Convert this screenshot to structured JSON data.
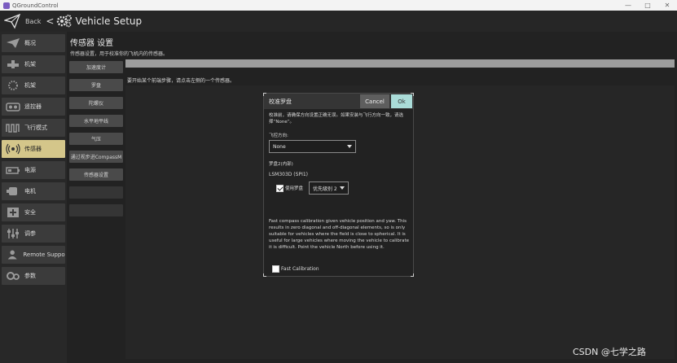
{
  "window": {
    "title": "QGroundControl",
    "controls": [
      "—",
      "□",
      "✕"
    ]
  },
  "toolbar": {
    "back_label": "Back",
    "back_arrow": "<",
    "title": "Vehicle Setup"
  },
  "sidebar": {
    "items": [
      {
        "label": "概况",
        "icon": "plane-icon",
        "active": false
      },
      {
        "label": "机架",
        "icon": "airframe-icon",
        "active": false
      },
      {
        "label": "机架",
        "icon": "spinner-icon",
        "active": false
      },
      {
        "label": "遥控器",
        "icon": "radio-icon",
        "active": false
      },
      {
        "label": "飞行模式",
        "icon": "waveform-icon",
        "active": false
      },
      {
        "label": "传感器",
        "icon": "signal-icon",
        "active": true
      },
      {
        "label": "电源",
        "icon": "battery-icon",
        "active": false
      },
      {
        "label": "电机",
        "icon": "motor-icon",
        "active": false
      },
      {
        "label": "安全",
        "icon": "safety-icon",
        "active": false
      },
      {
        "label": "调参",
        "icon": "tuning-icon",
        "active": false
      },
      {
        "label": "Remote Support",
        "icon": "person-icon",
        "active": false
      },
      {
        "label": "参数",
        "icon": "gears-icon",
        "active": false
      }
    ]
  },
  "main": {
    "heading": "传感器 设置",
    "subheading": "传感器设置，用于校准你的飞机内的传感器。",
    "instruction": "要开始某个前端步骤，请点击左侧的一个传感器。",
    "sensor_buttons": [
      {
        "label": "加速度计",
        "enabled": true
      },
      {
        "label": "罗盘",
        "enabled": true
      },
      {
        "label": "陀螺仪",
        "enabled": true
      },
      {
        "label": "水平地平线",
        "enabled": true
      },
      {
        "label": "气压",
        "enabled": true
      },
      {
        "label": "通过视步进CompassM",
        "enabled": true
      },
      {
        "label": "传感器设置",
        "enabled": true
      },
      {
        "label": "",
        "enabled": false
      },
      {
        "label": "",
        "enabled": false
      }
    ],
    "progress": 1.0
  },
  "dialog": {
    "title": "校准罗盘",
    "cancel_label": "Cancel",
    "ok_label": "Ok",
    "intro": "校准前，请确保方向设置正确无误。如果安装与飞行方向一致，请选择“None”。",
    "orientation_label": "飞控方向:",
    "orientation_value": "None",
    "compass_label": "罗盘2(内部)",
    "compass_name": "LSM303D (SPI1)",
    "use_compass_label": "使用罗盘",
    "use_compass_checked": true,
    "priority_value": "优先级别 2",
    "fast_desc": "Fast compass calibration given vehicle position and yaw. This results in zero diagonal and off-diagonal elements, so is only suitable for vehicles where the field is close to spherical. It is useful for large vehicles where moving the vehicle to calibrate it is difficult. Point the vehicle North before using it.",
    "fast_calibration_label": "Fast Calibration",
    "fast_calibration_checked": false
  },
  "watermark": "CSDN @七学之路"
}
